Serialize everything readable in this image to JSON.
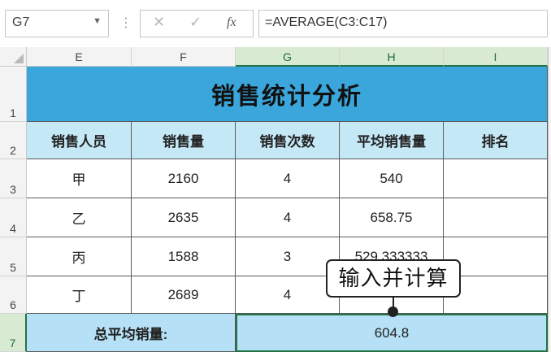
{
  "formula_bar": {
    "name_box": "G7",
    "cancel_icon": "✕",
    "enter_icon": "✓",
    "fx_icon": "fx",
    "formula": "=AVERAGE(C3:C17)"
  },
  "columns": [
    "E",
    "F",
    "G",
    "H",
    "I"
  ],
  "rows": [
    "1",
    "2",
    "3",
    "4",
    "5",
    "6",
    "7"
  ],
  "sheet": {
    "title": "销售统计分析",
    "headers": [
      "销售人员",
      "销售量",
      "销售次数",
      "平均销售量",
      "排名"
    ],
    "data": [
      [
        "甲",
        "2160",
        "4",
        "540",
        ""
      ],
      [
        "乙",
        "2635",
        "4",
        "658.75",
        ""
      ],
      [
        "丙",
        "1588",
        "3",
        "529.333333",
        ""
      ],
      [
        "丁",
        "2689",
        "4",
        "",
        ""
      ]
    ],
    "total_label": "总平均销量:",
    "total_value": "604.8"
  },
  "callout": "输入并计算",
  "colors": {
    "title_bg": "#3aa6dc",
    "header_bg": "#c5e8f7",
    "total_bg": "#b5e0f5",
    "selection": "#217346"
  }
}
